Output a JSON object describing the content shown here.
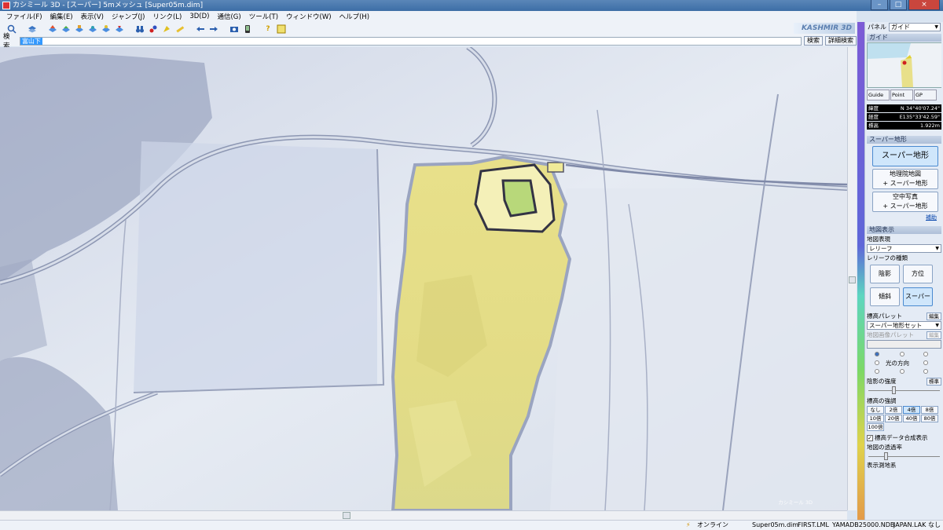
{
  "window": {
    "title": "カシミール 3D - [スーパー] 5mメッシュ [Super05m.dim]",
    "buttons": [
      "–",
      "□",
      "×"
    ]
  },
  "menu": [
    "ファイル(F)",
    "編集(E)",
    "表示(V)",
    "ジャンプ(J)",
    "リンク(L)",
    "3D(D)",
    "通信(G)",
    "ツール(T)",
    "ウィンドウ(W)",
    "ヘルプ(H)"
  ],
  "toolbar": {
    "brand": "KASHMIR 3D",
    "icons": [
      "zoom-icon",
      "layers-icon",
      "globe1-icon",
      "globe2-icon",
      "globe3-icon",
      "globe4-icon",
      "globe5-icon",
      "globe6-icon",
      "binoculars-icon",
      "tag-icon",
      "cursor-icon",
      "ruler-icon",
      "arrow-left-icon",
      "arrow-right-icon",
      "camera-icon",
      "phone-icon",
      "help-icon",
      "info-icon"
    ]
  },
  "search": {
    "label": "検索",
    "value": "富山下",
    "button": "検索",
    "detail_button": "詳細検索"
  },
  "map": {
    "watermark": "カシミール 3D"
  },
  "status": {
    "online": "オンライン",
    "file": "Super05m.dim",
    "lml": "FIRST.LML",
    "ndb": "YAMADB25000.NDB",
    "lak": "JAPAN.LAK",
    "none": "なし"
  },
  "panel": {
    "label": "パネル",
    "selected": "ガイド",
    "guide_section": "ガイド",
    "tabs": [
      "Guide",
      "Point",
      "GP"
    ],
    "coords": [
      {
        "label": "緯度",
        "value": "N 34°40'07.24\""
      },
      {
        "label": "経度",
        "value": "E135°33'42.59\""
      },
      {
        "label": "標高",
        "value": "1.922m"
      }
    ],
    "super_section": "スーパー地形",
    "super_btn": "スーパー地形",
    "gsi_btn_1": "地理院地図",
    "gsi_btn_2": "+ スーパー地形",
    "aerial_btn_1": "空中写真",
    "aerial_btn_2": "+ スーパー地形",
    "help_link": "補助",
    "map_section": "地図表示",
    "map_expr_label": "地図表現",
    "map_expr_value": "レリーフ",
    "relief_type_label": "レリーフの種類",
    "relief_buttons": [
      "陰影",
      "方位",
      "傾斜",
      "スーパー"
    ],
    "palette_label": "標高パレット",
    "edit": "編集",
    "palette_value": "スーパー地形セット",
    "map_palette_label": "地図画像パレット",
    "light_dir": "光の方向",
    "shade_strength": "陰影の強度",
    "standard": "標準",
    "elev_emph": "標高の強調",
    "emph_options": [
      "なし",
      "2倍",
      "4倍",
      "8倍",
      "10倍",
      "20倍",
      "40倍",
      "80倍",
      "100倍"
    ],
    "emph_selected": "4倍",
    "compose_label": "標高データ合成表示",
    "transparency": "地図の透過率",
    "display_system": "表示測地系"
  },
  "colors": {
    "title_bar": "#4a79b0",
    "accent": "#4a8ad0",
    "terrain_high": "#e8e08a",
    "terrain_low": "#c9d3e6"
  }
}
